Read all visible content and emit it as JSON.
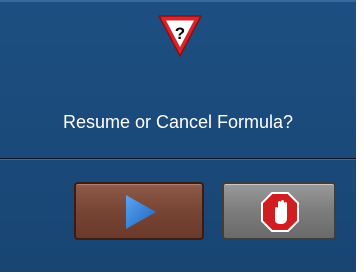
{
  "dialog": {
    "icon": "warning-question-icon",
    "icon_glyph": "?",
    "message": "Resume or Cancel Formula?",
    "resume_button": {
      "icon": "play-icon"
    },
    "cancel_button": {
      "icon": "stop-hand-icon"
    }
  },
  "colors": {
    "background": "#1a4979",
    "warning_red": "#d8242a",
    "resume_button": "#7a4635",
    "play_blue": "#2f7bd6",
    "cancel_button": "#7c7c7c",
    "stop_red": "#d21d20"
  }
}
